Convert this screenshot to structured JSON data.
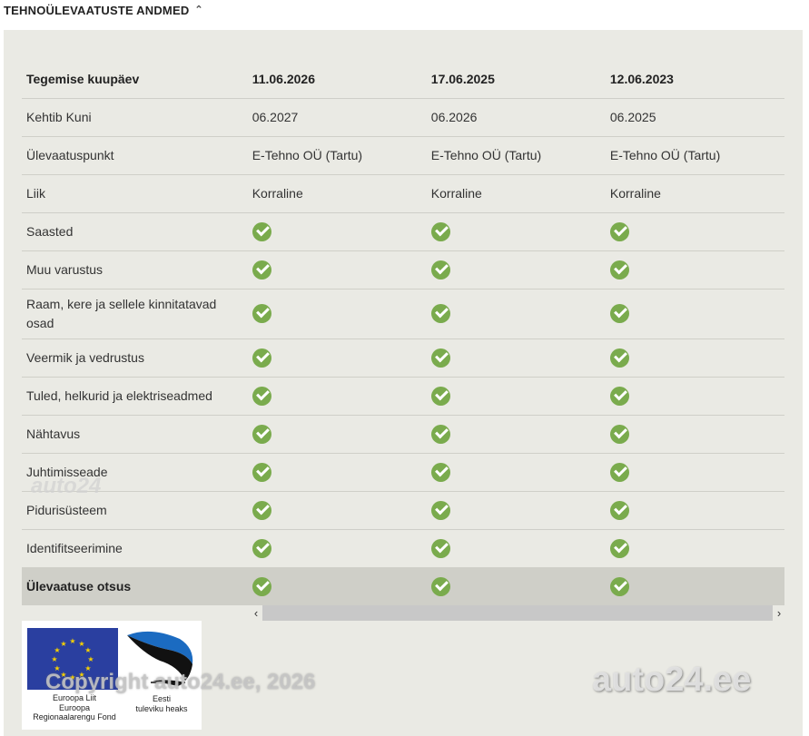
{
  "section": {
    "title": "TEHNOÜLEVAATUSTE ANDMED",
    "collapse_icon": "double-chevron-up-icon"
  },
  "table": {
    "header": {
      "label": "Tegemise kuupäev",
      "dates": [
        "11.06.2026",
        "17.06.2025",
        "12.06.2023"
      ]
    },
    "rows": [
      {
        "label": "Kehtib Kuni",
        "values": [
          "06.2027",
          "06.2026",
          "06.2025"
        ]
      },
      {
        "label": "Ülevaatuspunkt",
        "values": [
          "E-Tehno OÜ (Tartu)",
          "E-Tehno OÜ (Tartu)",
          "E-Tehno OÜ (Tartu)"
        ]
      },
      {
        "label": "Liik",
        "values": [
          "Korraline",
          "Korraline",
          "Korraline"
        ]
      }
    ],
    "check_rows": [
      {
        "label": "Saasted",
        "status": [
          "pass",
          "pass",
          "pass"
        ]
      },
      {
        "label": "Muu varustus",
        "status": [
          "pass",
          "pass",
          "pass"
        ]
      },
      {
        "label": "Raam, kere ja sellele kinnitatavad osad",
        "status": [
          "pass",
          "pass",
          "pass"
        ]
      },
      {
        "label": "Veermik ja vedrustus",
        "status": [
          "pass",
          "pass",
          "pass"
        ]
      },
      {
        "label": "Tuled, helkurid ja elektriseadmed",
        "status": [
          "pass",
          "pass",
          "pass"
        ]
      },
      {
        "label": "Nähtavus",
        "status": [
          "pass",
          "pass",
          "pass"
        ]
      },
      {
        "label": "Juhtimisseade",
        "status": [
          "pass",
          "pass",
          "pass"
        ]
      },
      {
        "label": "Pidurisüsteem",
        "status": [
          "pass",
          "pass",
          "pass"
        ]
      },
      {
        "label": "Identifitseerimine",
        "status": [
          "pass",
          "pass",
          "pass"
        ]
      }
    ],
    "decision": {
      "label": "Ülevaatuse otsus",
      "status": [
        "pass",
        "pass",
        "pass"
      ]
    }
  },
  "scrollbar": {
    "left_arrow": "‹",
    "right_arrow": "›"
  },
  "logos": {
    "eu_text": [
      "Euroopa Liit",
      "Euroopa",
      "Regionaalarengu Fond"
    ],
    "ee_text": [
      "Eesti",
      "tuleviku heaks"
    ]
  },
  "watermarks": {
    "small": "auto24",
    "copyright": "Copyright auto24.ee, 2026",
    "brand": "auto24.ee"
  },
  "colors": {
    "panel_bg": "#eaeae4",
    "check_green": "#7aab4d",
    "decision_row_bg": "#cfcfc8",
    "eu_blue": "#2a3fa0",
    "eu_stars": "#f5d000"
  }
}
